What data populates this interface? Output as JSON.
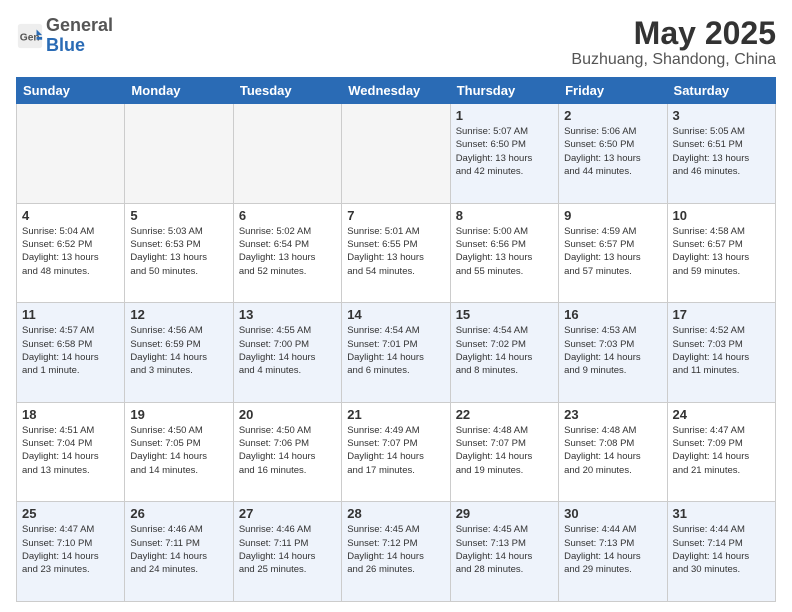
{
  "header": {
    "logo_general": "General",
    "logo_blue": "Blue",
    "month": "May 2025",
    "location": "Buzhuang, Shandong, China"
  },
  "weekdays": [
    "Sunday",
    "Monday",
    "Tuesday",
    "Wednesday",
    "Thursday",
    "Friday",
    "Saturday"
  ],
  "weeks": [
    [
      {
        "day": "",
        "info": ""
      },
      {
        "day": "",
        "info": ""
      },
      {
        "day": "",
        "info": ""
      },
      {
        "day": "",
        "info": ""
      },
      {
        "day": "1",
        "info": "Sunrise: 5:07 AM\nSunset: 6:50 PM\nDaylight: 13 hours\nand 42 minutes."
      },
      {
        "day": "2",
        "info": "Sunrise: 5:06 AM\nSunset: 6:50 PM\nDaylight: 13 hours\nand 44 minutes."
      },
      {
        "day": "3",
        "info": "Sunrise: 5:05 AM\nSunset: 6:51 PM\nDaylight: 13 hours\nand 46 minutes."
      }
    ],
    [
      {
        "day": "4",
        "info": "Sunrise: 5:04 AM\nSunset: 6:52 PM\nDaylight: 13 hours\nand 48 minutes."
      },
      {
        "day": "5",
        "info": "Sunrise: 5:03 AM\nSunset: 6:53 PM\nDaylight: 13 hours\nand 50 minutes."
      },
      {
        "day": "6",
        "info": "Sunrise: 5:02 AM\nSunset: 6:54 PM\nDaylight: 13 hours\nand 52 minutes."
      },
      {
        "day": "7",
        "info": "Sunrise: 5:01 AM\nSunset: 6:55 PM\nDaylight: 13 hours\nand 54 minutes."
      },
      {
        "day": "8",
        "info": "Sunrise: 5:00 AM\nSunset: 6:56 PM\nDaylight: 13 hours\nand 55 minutes."
      },
      {
        "day": "9",
        "info": "Sunrise: 4:59 AM\nSunset: 6:57 PM\nDaylight: 13 hours\nand 57 minutes."
      },
      {
        "day": "10",
        "info": "Sunrise: 4:58 AM\nSunset: 6:57 PM\nDaylight: 13 hours\nand 59 minutes."
      }
    ],
    [
      {
        "day": "11",
        "info": "Sunrise: 4:57 AM\nSunset: 6:58 PM\nDaylight: 14 hours\nand 1 minute."
      },
      {
        "day": "12",
        "info": "Sunrise: 4:56 AM\nSunset: 6:59 PM\nDaylight: 14 hours\nand 3 minutes."
      },
      {
        "day": "13",
        "info": "Sunrise: 4:55 AM\nSunset: 7:00 PM\nDaylight: 14 hours\nand 4 minutes."
      },
      {
        "day": "14",
        "info": "Sunrise: 4:54 AM\nSunset: 7:01 PM\nDaylight: 14 hours\nand 6 minutes."
      },
      {
        "day": "15",
        "info": "Sunrise: 4:54 AM\nSunset: 7:02 PM\nDaylight: 14 hours\nand 8 minutes."
      },
      {
        "day": "16",
        "info": "Sunrise: 4:53 AM\nSunset: 7:03 PM\nDaylight: 14 hours\nand 9 minutes."
      },
      {
        "day": "17",
        "info": "Sunrise: 4:52 AM\nSunset: 7:03 PM\nDaylight: 14 hours\nand 11 minutes."
      }
    ],
    [
      {
        "day": "18",
        "info": "Sunrise: 4:51 AM\nSunset: 7:04 PM\nDaylight: 14 hours\nand 13 minutes."
      },
      {
        "day": "19",
        "info": "Sunrise: 4:50 AM\nSunset: 7:05 PM\nDaylight: 14 hours\nand 14 minutes."
      },
      {
        "day": "20",
        "info": "Sunrise: 4:50 AM\nSunset: 7:06 PM\nDaylight: 14 hours\nand 16 minutes."
      },
      {
        "day": "21",
        "info": "Sunrise: 4:49 AM\nSunset: 7:07 PM\nDaylight: 14 hours\nand 17 minutes."
      },
      {
        "day": "22",
        "info": "Sunrise: 4:48 AM\nSunset: 7:07 PM\nDaylight: 14 hours\nand 19 minutes."
      },
      {
        "day": "23",
        "info": "Sunrise: 4:48 AM\nSunset: 7:08 PM\nDaylight: 14 hours\nand 20 minutes."
      },
      {
        "day": "24",
        "info": "Sunrise: 4:47 AM\nSunset: 7:09 PM\nDaylight: 14 hours\nand 21 minutes."
      }
    ],
    [
      {
        "day": "25",
        "info": "Sunrise: 4:47 AM\nSunset: 7:10 PM\nDaylight: 14 hours\nand 23 minutes."
      },
      {
        "day": "26",
        "info": "Sunrise: 4:46 AM\nSunset: 7:11 PM\nDaylight: 14 hours\nand 24 minutes."
      },
      {
        "day": "27",
        "info": "Sunrise: 4:46 AM\nSunset: 7:11 PM\nDaylight: 14 hours\nand 25 minutes."
      },
      {
        "day": "28",
        "info": "Sunrise: 4:45 AM\nSunset: 7:12 PM\nDaylight: 14 hours\nand 26 minutes."
      },
      {
        "day": "29",
        "info": "Sunrise: 4:45 AM\nSunset: 7:13 PM\nDaylight: 14 hours\nand 28 minutes."
      },
      {
        "day": "30",
        "info": "Sunrise: 4:44 AM\nSunset: 7:13 PM\nDaylight: 14 hours\nand 29 minutes."
      },
      {
        "day": "31",
        "info": "Sunrise: 4:44 AM\nSunset: 7:14 PM\nDaylight: 14 hours\nand 30 minutes."
      }
    ]
  ]
}
